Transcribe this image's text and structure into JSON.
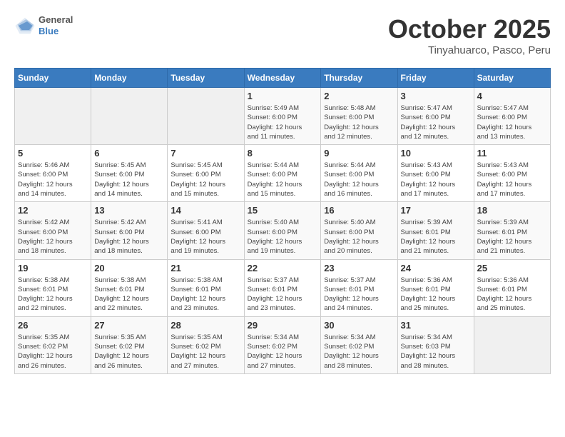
{
  "header": {
    "logo": {
      "general": "General",
      "blue": "Blue"
    },
    "title": "October 2025",
    "location": "Tinyahuarco, Pasco, Peru"
  },
  "calendar": {
    "weekdays": [
      "Sunday",
      "Monday",
      "Tuesday",
      "Wednesday",
      "Thursday",
      "Friday",
      "Saturday"
    ],
    "weeks": [
      [
        {
          "day": "",
          "info": ""
        },
        {
          "day": "",
          "info": ""
        },
        {
          "day": "",
          "info": ""
        },
        {
          "day": "1",
          "info": "Sunrise: 5:49 AM\nSunset: 6:00 PM\nDaylight: 12 hours\nand 11 minutes."
        },
        {
          "day": "2",
          "info": "Sunrise: 5:48 AM\nSunset: 6:00 PM\nDaylight: 12 hours\nand 12 minutes."
        },
        {
          "day": "3",
          "info": "Sunrise: 5:47 AM\nSunset: 6:00 PM\nDaylight: 12 hours\nand 12 minutes."
        },
        {
          "day": "4",
          "info": "Sunrise: 5:47 AM\nSunset: 6:00 PM\nDaylight: 12 hours\nand 13 minutes."
        }
      ],
      [
        {
          "day": "5",
          "info": "Sunrise: 5:46 AM\nSunset: 6:00 PM\nDaylight: 12 hours\nand 14 minutes."
        },
        {
          "day": "6",
          "info": "Sunrise: 5:45 AM\nSunset: 6:00 PM\nDaylight: 12 hours\nand 14 minutes."
        },
        {
          "day": "7",
          "info": "Sunrise: 5:45 AM\nSunset: 6:00 PM\nDaylight: 12 hours\nand 15 minutes."
        },
        {
          "day": "8",
          "info": "Sunrise: 5:44 AM\nSunset: 6:00 PM\nDaylight: 12 hours\nand 15 minutes."
        },
        {
          "day": "9",
          "info": "Sunrise: 5:44 AM\nSunset: 6:00 PM\nDaylight: 12 hours\nand 16 minutes."
        },
        {
          "day": "10",
          "info": "Sunrise: 5:43 AM\nSunset: 6:00 PM\nDaylight: 12 hours\nand 17 minutes."
        },
        {
          "day": "11",
          "info": "Sunrise: 5:43 AM\nSunset: 6:00 PM\nDaylight: 12 hours\nand 17 minutes."
        }
      ],
      [
        {
          "day": "12",
          "info": "Sunrise: 5:42 AM\nSunset: 6:00 PM\nDaylight: 12 hours\nand 18 minutes."
        },
        {
          "day": "13",
          "info": "Sunrise: 5:42 AM\nSunset: 6:00 PM\nDaylight: 12 hours\nand 18 minutes."
        },
        {
          "day": "14",
          "info": "Sunrise: 5:41 AM\nSunset: 6:00 PM\nDaylight: 12 hours\nand 19 minutes."
        },
        {
          "day": "15",
          "info": "Sunrise: 5:40 AM\nSunset: 6:00 PM\nDaylight: 12 hours\nand 19 minutes."
        },
        {
          "day": "16",
          "info": "Sunrise: 5:40 AM\nSunset: 6:00 PM\nDaylight: 12 hours\nand 20 minutes."
        },
        {
          "day": "17",
          "info": "Sunrise: 5:39 AM\nSunset: 6:01 PM\nDaylight: 12 hours\nand 21 minutes."
        },
        {
          "day": "18",
          "info": "Sunrise: 5:39 AM\nSunset: 6:01 PM\nDaylight: 12 hours\nand 21 minutes."
        }
      ],
      [
        {
          "day": "19",
          "info": "Sunrise: 5:38 AM\nSunset: 6:01 PM\nDaylight: 12 hours\nand 22 minutes."
        },
        {
          "day": "20",
          "info": "Sunrise: 5:38 AM\nSunset: 6:01 PM\nDaylight: 12 hours\nand 22 minutes."
        },
        {
          "day": "21",
          "info": "Sunrise: 5:38 AM\nSunset: 6:01 PM\nDaylight: 12 hours\nand 23 minutes."
        },
        {
          "day": "22",
          "info": "Sunrise: 5:37 AM\nSunset: 6:01 PM\nDaylight: 12 hours\nand 23 minutes."
        },
        {
          "day": "23",
          "info": "Sunrise: 5:37 AM\nSunset: 6:01 PM\nDaylight: 12 hours\nand 24 minutes."
        },
        {
          "day": "24",
          "info": "Sunrise: 5:36 AM\nSunset: 6:01 PM\nDaylight: 12 hours\nand 25 minutes."
        },
        {
          "day": "25",
          "info": "Sunrise: 5:36 AM\nSunset: 6:01 PM\nDaylight: 12 hours\nand 25 minutes."
        }
      ],
      [
        {
          "day": "26",
          "info": "Sunrise: 5:35 AM\nSunset: 6:02 PM\nDaylight: 12 hours\nand 26 minutes."
        },
        {
          "day": "27",
          "info": "Sunrise: 5:35 AM\nSunset: 6:02 PM\nDaylight: 12 hours\nand 26 minutes."
        },
        {
          "day": "28",
          "info": "Sunrise: 5:35 AM\nSunset: 6:02 PM\nDaylight: 12 hours\nand 27 minutes."
        },
        {
          "day": "29",
          "info": "Sunrise: 5:34 AM\nSunset: 6:02 PM\nDaylight: 12 hours\nand 27 minutes."
        },
        {
          "day": "30",
          "info": "Sunrise: 5:34 AM\nSunset: 6:02 PM\nDaylight: 12 hours\nand 28 minutes."
        },
        {
          "day": "31",
          "info": "Sunrise: 5:34 AM\nSunset: 6:03 PM\nDaylight: 12 hours\nand 28 minutes."
        },
        {
          "day": "",
          "info": ""
        }
      ]
    ]
  }
}
